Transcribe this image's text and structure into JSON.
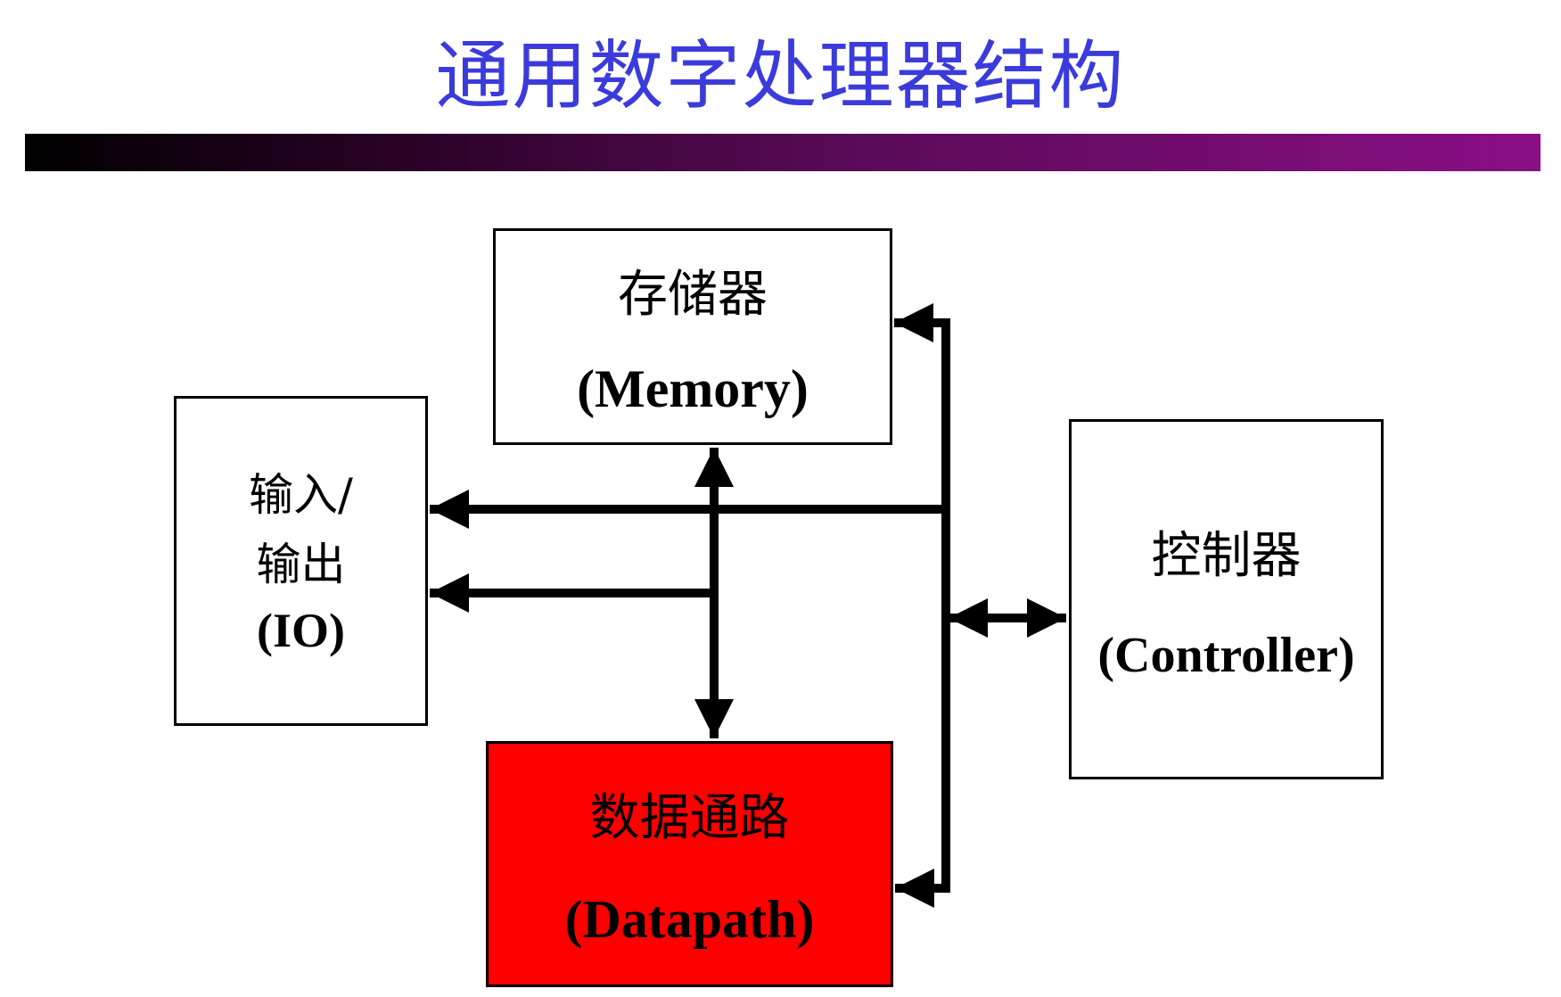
{
  "title": "通用数字处理器结构",
  "blocks": {
    "memory": {
      "cn": "存储器",
      "en": "(Memory)"
    },
    "io": {
      "cn_line1": "输入/",
      "cn_line2": "输出",
      "en": "(IO)"
    },
    "controller": {
      "cn": "控制器",
      "en": "(Controller)"
    },
    "datapath": {
      "cn": "数据通路",
      "en": "(Datapath)"
    }
  },
  "colors": {
    "title": "#3b3bdc",
    "datapath_fill": "#ff0000",
    "bar_start": "#000000",
    "bar_end": "#8a0f86",
    "wire": "#000000"
  },
  "connections": [
    {
      "from": "memory",
      "to": "datapath",
      "direction": "bidirectional"
    },
    {
      "from": "bus",
      "to": "memory",
      "direction": "to-target"
    },
    {
      "from": "bus",
      "to": "io",
      "direction": "to-target"
    },
    {
      "from": "datapath",
      "to": "io",
      "direction": "to-target"
    },
    {
      "from": "bus",
      "to": "datapath",
      "direction": "to-target"
    },
    {
      "from": "bus",
      "to": "controller",
      "direction": "bidirectional"
    }
  ]
}
